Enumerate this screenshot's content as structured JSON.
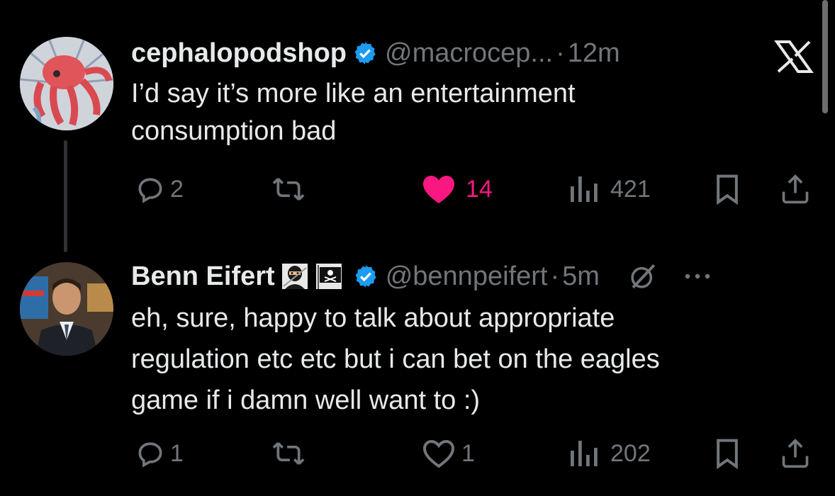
{
  "tweets": [
    {
      "name": "cephalopodshop",
      "handle": "@macrocep...",
      "separator": "·",
      "time": "12m",
      "text_line1": "I’d say it’s more like an entertainment",
      "text_line2": "consumption bad",
      "replies": "2",
      "retweets": "",
      "likes": "14",
      "liked": true,
      "views": "421"
    },
    {
      "name": "Benn Eifert",
      "name_emojis": [
        "ninja-emoji",
        "pirate-flag-emoji"
      ],
      "handle": "@bennpeifert",
      "separator": "·",
      "time": "5m",
      "text_line1": "eh, sure, happy to talk about appropriate",
      "text_line2": "regulation etc etc but i can bet on the eagles",
      "text_line3": "game if i damn well want to :)",
      "replies": "1",
      "retweets": "",
      "likes": "1",
      "liked": false,
      "views": "202"
    }
  ],
  "colors": {
    "background": "#000000",
    "text": "#e7e9ea",
    "secondary": "#71767b",
    "verified": "#1d9bf0",
    "like": "#f91880"
  },
  "icons": [
    "x-close-icon",
    "verified-badge-icon",
    "reply-icon",
    "retweet-icon",
    "heart-icon",
    "views-icon",
    "bookmark-icon",
    "share-icon",
    "grok-icon",
    "more-icon"
  ]
}
